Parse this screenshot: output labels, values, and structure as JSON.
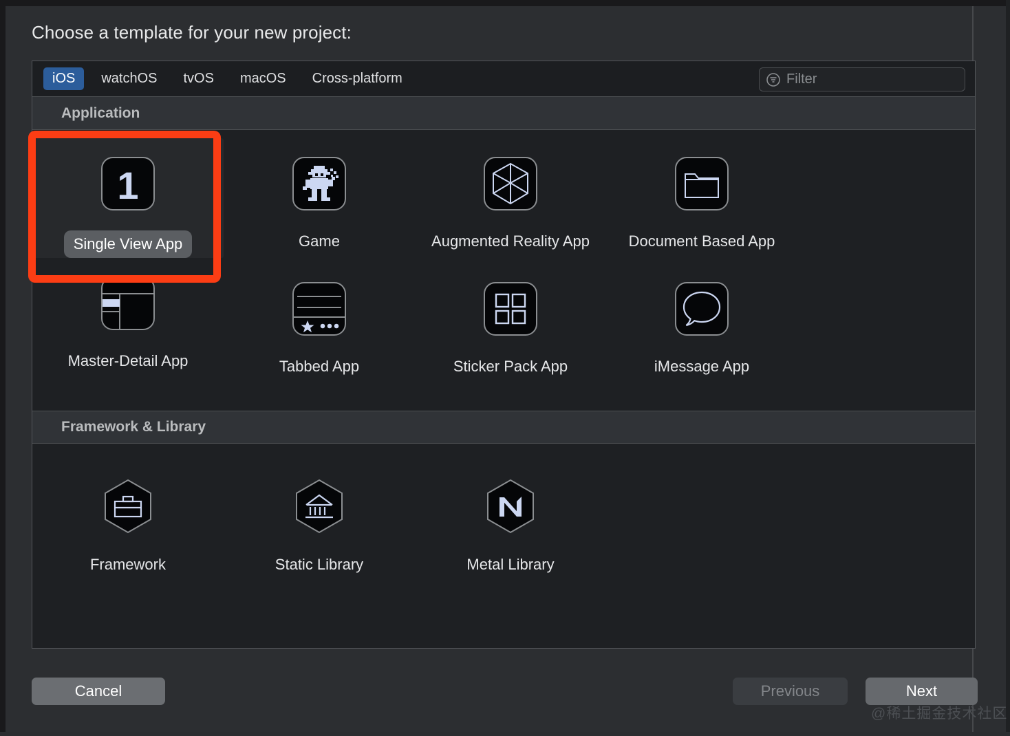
{
  "dialog": {
    "heading": "Choose a template for your new project:"
  },
  "tabs": [
    {
      "label": "iOS",
      "selected": true
    },
    {
      "label": "watchOS",
      "selected": false
    },
    {
      "label": "tvOS",
      "selected": false
    },
    {
      "label": "macOS",
      "selected": false
    },
    {
      "label": "Cross-platform",
      "selected": false
    }
  ],
  "filter": {
    "placeholder": "Filter",
    "value": "",
    "icon": "filter-icon"
  },
  "sections": [
    {
      "title": "Application",
      "items": [
        {
          "label": "Single View App",
          "icon": "number-one-icon",
          "selected": true,
          "annotated": true
        },
        {
          "label": "Game",
          "icon": "game-robot-icon",
          "selected": false
        },
        {
          "label": "Augmented Reality App",
          "icon": "ar-cube-icon",
          "selected": false
        },
        {
          "label": "Document Based App",
          "icon": "folder-icon",
          "selected": false
        },
        {
          "label": "Master-Detail App",
          "icon": "split-view-icon",
          "selected": false
        },
        {
          "label": "Tabbed App",
          "icon": "tab-bar-icon",
          "selected": false
        },
        {
          "label": "Sticker Pack App",
          "icon": "grid-four-icon",
          "selected": false
        },
        {
          "label": "iMessage App",
          "icon": "speech-bubble-icon",
          "selected": false
        }
      ]
    },
    {
      "title": "Framework & Library",
      "items": [
        {
          "label": "Framework",
          "icon": "briefcase-hexagon-icon",
          "selected": false
        },
        {
          "label": "Static Library",
          "icon": "bank-hexagon-icon",
          "selected": false
        },
        {
          "label": "Metal Library",
          "icon": "metal-m-hexagon-icon",
          "selected": false
        }
      ]
    }
  ],
  "footer": {
    "cancel_label": "Cancel",
    "previous_label": "Previous",
    "next_label": "Next"
  },
  "watermark": "@稀土掘金技术社区",
  "colors": {
    "accent_tab": "#2c5d9b",
    "annotation": "#fc3d14",
    "icon_glyph": "#ccd7f2",
    "panel_bg": "#1e2023",
    "section_header_bg": "#303337"
  }
}
